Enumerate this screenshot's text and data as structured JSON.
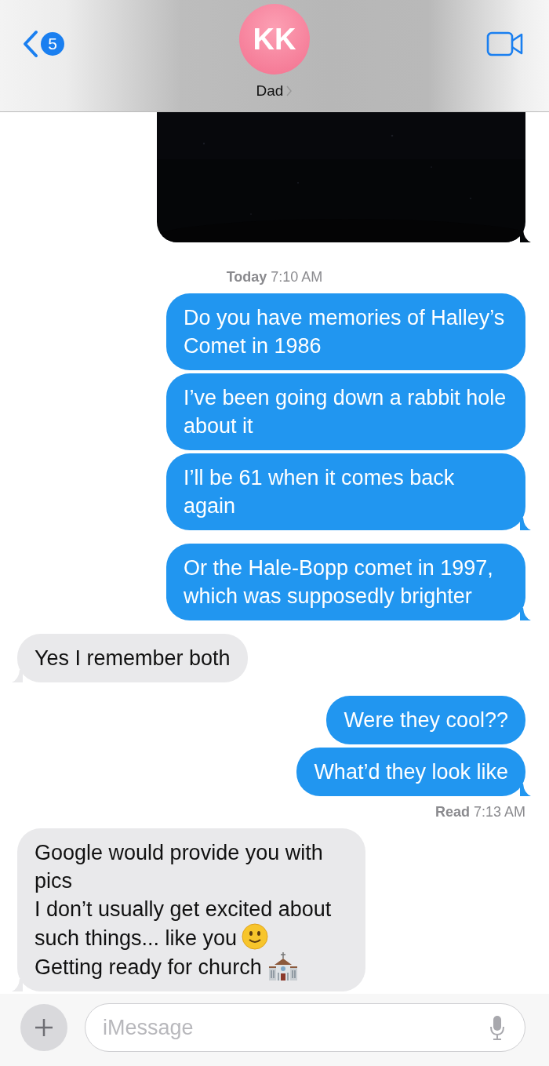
{
  "header": {
    "back_badge": "5",
    "avatar_initials": "KK",
    "contact_name": "Dad"
  },
  "thread": [
    {
      "kind": "picture",
      "tail": true
    },
    {
      "kind": "timestamp",
      "text": "**Today** 7:10 AM"
    },
    {
      "kind": "sent",
      "tail": false,
      "text": "Do you have memories of Halley’s Comet in 1986"
    },
    {
      "kind": "sent",
      "tail": false,
      "text": "I’ve been going down a rabbit hole about it"
    },
    {
      "kind": "sent",
      "tail": true,
      "text": "I’ll be 61 when it comes back again"
    },
    {
      "kind": "sent",
      "tail": true,
      "text": "Or the Hale-Bopp comet in 1997, which was supposedly brighter"
    },
    {
      "kind": "received",
      "tail": true,
      "text": "Yes I remember both"
    },
    {
      "kind": "sent",
      "tail": false,
      "text": "Were they cool??"
    },
    {
      "kind": "sent",
      "tail": true,
      "text": "What’d they look like"
    },
    {
      "kind": "receipt",
      "text": "**Read** 7:13 AM"
    },
    {
      "kind": "received",
      "tail": true,
      "lines": [
        {
          "kind": "plain",
          "text": "Google would provide you with pics"
        },
        {
          "kind": "smiley",
          "text": "I don’t usually get excited about such things... like you"
        },
        {
          "kind": "church",
          "text": "Getting ready for church"
        }
      ]
    }
  ],
  "composer": {
    "placeholder": "iMessage"
  }
}
